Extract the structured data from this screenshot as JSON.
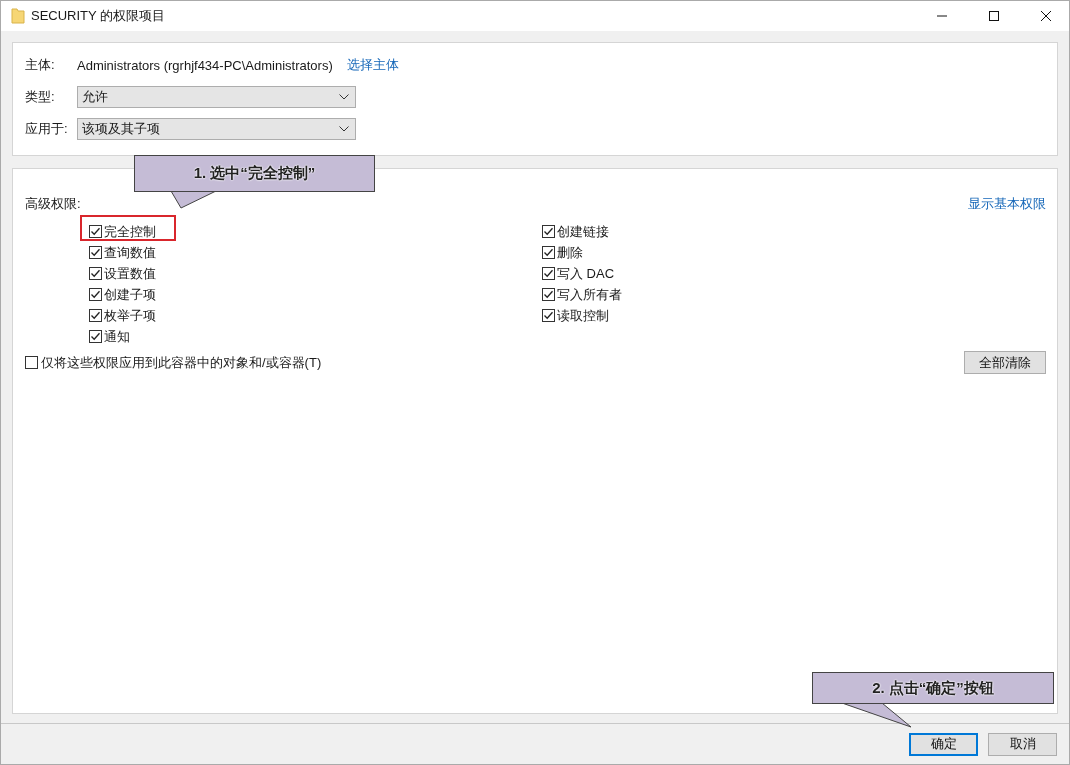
{
  "window": {
    "title": "SECURITY 的权限项目"
  },
  "principal": {
    "label": "主体:",
    "value": "Administrators (rgrhjf434-PC\\Administrators)",
    "link": "选择主体"
  },
  "fields": [
    {
      "label": "类型:",
      "value": "允许"
    },
    {
      "label": "应用于:",
      "value": "该项及其子项"
    }
  ],
  "permissions": {
    "label": "高级权限:",
    "link": "显示基本权限",
    "columns": [
      [
        {
          "label": "完全控制",
          "checked": true,
          "highlighted": true
        },
        {
          "label": "查询数值",
          "checked": true,
          "highlighted": false
        },
        {
          "label": "设置数值",
          "checked": true,
          "highlighted": false
        },
        {
          "label": "创建子项",
          "checked": true,
          "highlighted": false
        },
        {
          "label": "枚举子项",
          "checked": true,
          "highlighted": false
        },
        {
          "label": "通知",
          "checked": true,
          "highlighted": false
        }
      ],
      [
        {
          "label": "创建链接",
          "checked": true,
          "highlighted": false
        },
        {
          "label": "删除",
          "checked": true,
          "highlighted": false
        },
        {
          "label": "写入 DAC",
          "checked": true,
          "highlighted": false
        },
        {
          "label": "写入所有者",
          "checked": true,
          "highlighted": false
        },
        {
          "label": "读取控制",
          "checked": true,
          "highlighted": false
        }
      ]
    ]
  },
  "apply_only": {
    "label": "仅将这些权限应用到此容器中的对象和/或容器(T)",
    "checked": false
  },
  "clear_button": "全部清除",
  "buttons": [
    {
      "label": "确定",
      "default": true
    },
    {
      "label": "取消",
      "default": false
    }
  ],
  "callouts": [
    {
      "text": "1. 选中“完全控制”"
    },
    {
      "text": "2. 点击“确定”按钮"
    }
  ]
}
